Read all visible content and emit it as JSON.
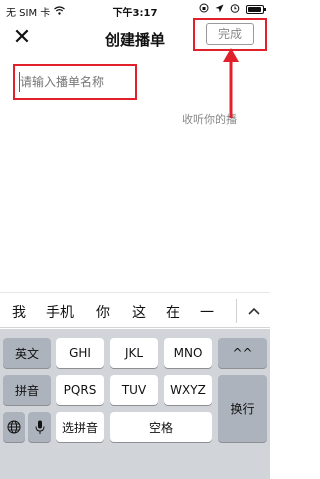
{
  "status_bar": {
    "carrier": "无 SIM 卡",
    "wifi_icon": "wifi-icon",
    "time": "下午3:17",
    "icons": [
      "rotation-lock-icon",
      "location-arrow-icon",
      "alarm-icon"
    ],
    "battery_level": 0.9
  },
  "nav": {
    "close_icon": "close-icon",
    "title": "创建播单",
    "done_label": "完成"
  },
  "form": {
    "name_placeholder": "请输入播单名称",
    "hint_text": "收听你的播"
  },
  "annotations": {
    "highlight_color": "#e0202a"
  },
  "keyboard": {
    "candidates": [
      "我",
      "手机",
      "你",
      "这",
      "在",
      "一"
    ],
    "expand_icon": "chevron-up-icon",
    "row1": [
      "英文",
      "GHI",
      "JKL",
      "MNO",
      "^^"
    ],
    "row2": [
      "拼音",
      "PQRS",
      "TUV",
      "WXYZ"
    ],
    "row3": [
      "选拼音",
      "空格"
    ],
    "enter_label": "换行",
    "globe_icon": "globe-icon",
    "mic_icon": "microphone-icon"
  }
}
